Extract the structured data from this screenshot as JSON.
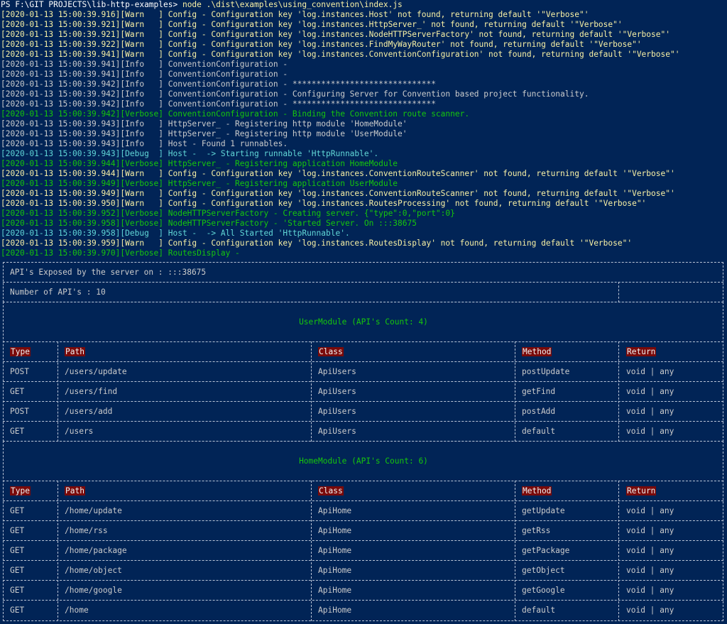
{
  "prompt": {
    "path": "PS F:\\GIT PROJECTS\\lib-http-examples> ",
    "command": "node .\\dist\\examples\\using_convention\\index.js"
  },
  "log": [
    {
      "level": "warn",
      "text": "[2020-01-13 15:00:39.916][Warn   ] Config - Configuration key 'log.instances.Host' not found, returning default '\"Verbose\"'"
    },
    {
      "level": "warn",
      "text": "[2020-01-13 15:00:39.921][Warn   ] Config - Configuration key 'log.instances.HttpServer_' not found, returning default '\"Verbose\"'"
    },
    {
      "level": "warn",
      "text": "[2020-01-13 15:00:39.921][Warn   ] Config - Configuration key 'log.instances.NodeHTTPServerFactory' not found, returning default '\"Verbose\"'"
    },
    {
      "level": "warn",
      "text": "[2020-01-13 15:00:39.922][Warn   ] Config - Configuration key 'log.instances.FindMyWayRouter' not found, returning default '\"Verbose\"'"
    },
    {
      "level": "warn",
      "text": "[2020-01-13 15:00:39.941][Warn   ] Config - Configuration key 'log.instances.ConventionConfiguration' not found, returning default '\"Verbose\"'"
    },
    {
      "level": "info",
      "text": "[2020-01-13 15:00:39.941][Info   ] ConventionConfiguration -"
    },
    {
      "level": "info",
      "text": "[2020-01-13 15:00:39.941][Info   ] ConventionConfiguration -"
    },
    {
      "level": "info",
      "text": "[2020-01-13 15:00:39.942][Info   ] ConventionConfiguration - ******************************"
    },
    {
      "level": "info",
      "text": "[2020-01-13 15:00:39.942][Info   ] ConventionConfiguration - Configuring Server for Convention based project functionality."
    },
    {
      "level": "info",
      "text": "[2020-01-13 15:00:39.942][Info   ] ConventionConfiguration - ******************************"
    },
    {
      "level": "verbose",
      "text": "[2020-01-13 15:00:39.942][Verbose] ConventionConfiguration - Binding the Convention route scanner."
    },
    {
      "level": "info",
      "text": "[2020-01-13 15:00:39.943][Info   ] HttpServer_ - Registering http module 'HomeModule'"
    },
    {
      "level": "info",
      "text": "[2020-01-13 15:00:39.943][Info   ] HttpServer_ - Registering http module 'UserModule'"
    },
    {
      "level": "info",
      "text": "[2020-01-13 15:00:39.943][Info   ] Host - Found 1 runnables."
    },
    {
      "level": "debug",
      "text": "[2020-01-13 15:00:39.943][Debug  ] Host -  -> Starting runnable 'HttpRunnable'."
    },
    {
      "level": "verbose",
      "text": "[2020-01-13 15:00:39.944][Verbose] HttpServer_ - Registering application HomeModule"
    },
    {
      "level": "warn",
      "text": "[2020-01-13 15:00:39.944][Warn   ] Config - Configuration key 'log.instances.ConventionRouteScanner' not found, returning default '\"Verbose\"'"
    },
    {
      "level": "verbose",
      "text": "[2020-01-13 15:00:39.949][Verbose] HttpServer_ - Registering application UserModule"
    },
    {
      "level": "warn",
      "text": "[2020-01-13 15:00:39.949][Warn   ] Config - Configuration key 'log.instances.ConventionRouteScanner' not found, returning default '\"Verbose\"'"
    },
    {
      "level": "warn",
      "text": "[2020-01-13 15:00:39.950][Warn   ] Config - Configuration key 'log.instances.RoutesProcessing' not found, returning default '\"Verbose\"'"
    },
    {
      "level": "verbose",
      "text": "[2020-01-13 15:00:39.952][Verbose] NodeHTTPServerFactory - Creating server. {\"type\":0,\"port\":0}"
    },
    {
      "level": "verbose",
      "text": "[2020-01-13 15:00:39.958][Verbose] NodeHTTPServerFactory - 'Started Server. On :::38675"
    },
    {
      "level": "debug",
      "text": "[2020-01-13 15:00:39.958][Debug  ] Host -  -> All Started 'HttpRunnable'."
    },
    {
      "level": "warn",
      "text": "[2020-01-13 15:00:39.959][Warn   ] Config - Configuration key 'log.instances.RoutesDisplay' not found, returning default '\"Verbose\"'"
    },
    {
      "level": "verbose",
      "text": "[2020-01-13 15:00:39.970][Verbose] RoutesDisplay -"
    }
  ],
  "routes_table": {
    "exposed_label": "API's Exposed by the server on : :::38675",
    "count_label": "Number of API's : 10",
    "headers": {
      "type": "Type",
      "path": "Path",
      "class": "Class",
      "method": "Method",
      "return": "Return"
    },
    "modules": [
      {
        "title": "UserModule (API's Count: 4)",
        "rows": [
          {
            "type": "POST",
            "path": "/users/update",
            "class": "ApiUsers",
            "method": "postUpdate",
            "return": "void | any"
          },
          {
            "type": "GET",
            "path": "/users/find",
            "class": "ApiUsers",
            "method": "getFind",
            "return": "void | any"
          },
          {
            "type": "POST",
            "path": "/users/add",
            "class": "ApiUsers",
            "method": "postAdd",
            "return": "void | any"
          },
          {
            "type": "GET",
            "path": "/users",
            "class": "ApiUsers",
            "method": "default",
            "return": "void | any"
          }
        ]
      },
      {
        "title": "HomeModule (API's Count: 6)",
        "rows": [
          {
            "type": "GET",
            "path": "/home/update",
            "class": "ApiHome",
            "method": "getUpdate",
            "return": "void | any"
          },
          {
            "type": "GET",
            "path": "/home/rss",
            "class": "ApiHome",
            "method": "getRss",
            "return": "void | any"
          },
          {
            "type": "GET",
            "path": "/home/package",
            "class": "ApiHome",
            "method": "getPackage",
            "return": "void | any"
          },
          {
            "type": "GET",
            "path": "/home/object",
            "class": "ApiHome",
            "method": "getObject",
            "return": "void | any"
          },
          {
            "type": "GET",
            "path": "/home/google",
            "class": "ApiHome",
            "method": "getGoogle",
            "return": "void | any"
          },
          {
            "type": "GET",
            "path": "/home",
            "class": "ApiHome",
            "method": "default",
            "return": "void | any"
          }
        ]
      }
    ]
  },
  "colors": {
    "background": "#012456",
    "warn": "#f9f1a5",
    "info": "#cccccc",
    "verbose": "#16c60c",
    "debug": "#61d6d6",
    "header_bg": "#7a0a0a"
  }
}
